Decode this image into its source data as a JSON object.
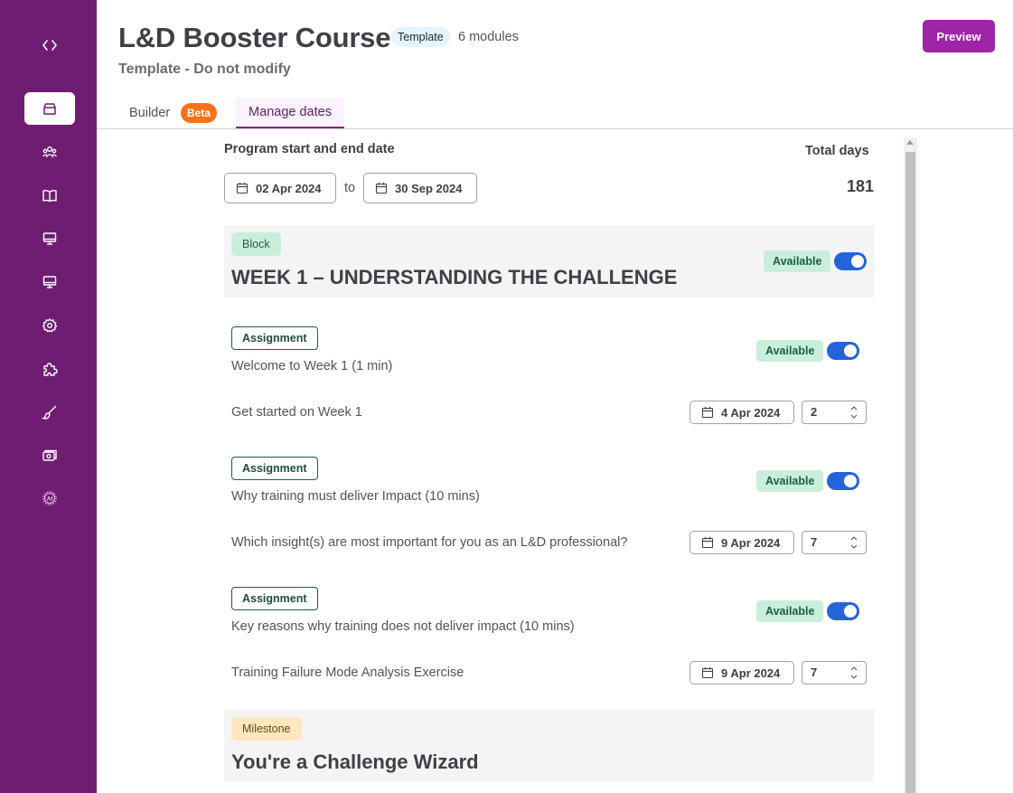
{
  "sidebar": {
    "icons": [
      "code-icon",
      "box-icon",
      "users-icon",
      "book-icon",
      "monitor-icon",
      "monitor-icon",
      "settings-icon",
      "puzzle-icon",
      "brush-icon",
      "camera-icon",
      "ai-icon"
    ],
    "active_index": 1,
    "color": "#6f1d72"
  },
  "header": {
    "title": "L&D Booster Course",
    "template_tag": "Template",
    "modules": "6 modules",
    "subtitle": "Template - Do not modify",
    "preview_label": "Preview"
  },
  "tabs": {
    "builder": "Builder",
    "beta": "Beta",
    "manage": "Manage dates"
  },
  "program": {
    "label": "Program start and end date",
    "start": "02 Apr 2024",
    "to": "to",
    "end": "30 Sep 2024",
    "total_label": "Total days",
    "total_value": "181"
  },
  "block": {
    "tag": "Block",
    "title": "WEEK 1 – UNDERSTANDING THE CHALLENGE",
    "available": "Available"
  },
  "items": [
    {
      "tag": "Assignment",
      "title": "Welcome to Week 1 (1 min)",
      "available": "Available",
      "task": "Get started on Week 1",
      "date": "4 Apr 2024",
      "days": "2"
    },
    {
      "tag": "Assignment",
      "title": "Why training must deliver Impact (10 mins)",
      "available": "Available",
      "task": "Which insight(s) are most important for you as an L&D professional?",
      "date": "9 Apr 2024",
      "days": "7"
    },
    {
      "tag": "Assignment",
      "title": "Key reasons why training does not deliver impact (10 mins)",
      "available": "Available",
      "task": "Training Failure Mode Analysis Exercise",
      "date": "9 Apr 2024",
      "days": "7"
    }
  ],
  "milestone": {
    "tag": "Milestone",
    "title": "You're a Challenge Wizard"
  }
}
